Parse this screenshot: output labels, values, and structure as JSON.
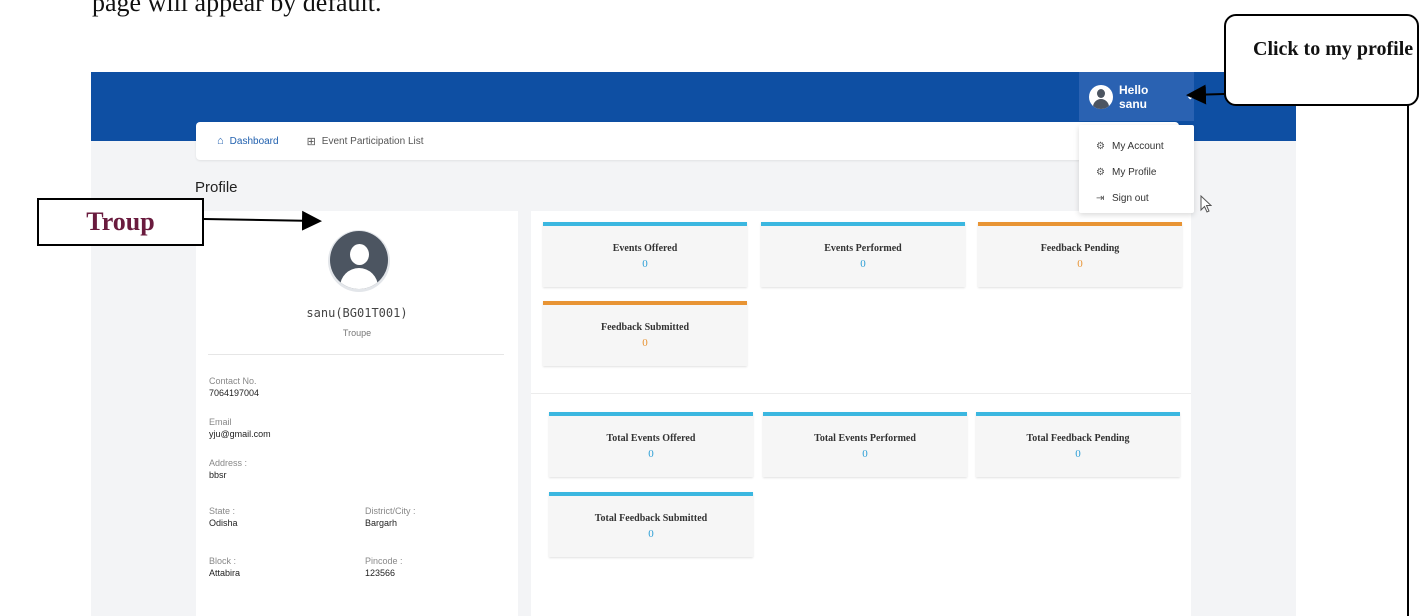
{
  "doc_text": "page will appear by default.",
  "header": {
    "user_greeting": "Hello sanu",
    "caret": "⌄"
  },
  "nav": {
    "items": [
      {
        "label": "Dashboard",
        "icon": "home-icon",
        "glyph": "⌂"
      },
      {
        "label": "Event Participation List",
        "icon": "grid-icon",
        "glyph": "⊞"
      }
    ]
  },
  "page_title": "Profile",
  "dropdown": {
    "items": [
      {
        "label": "My Account",
        "icon": "gear-icon",
        "glyph": "⚙"
      },
      {
        "label": "My Profile",
        "icon": "gear-icon",
        "glyph": "⚙"
      },
      {
        "label": "Sign out",
        "icon": "sign-out-icon",
        "glyph": "⇥"
      }
    ]
  },
  "profile": {
    "name": "sanu(BG01T001)",
    "role": "Troupe",
    "contact_label": "Contact No.",
    "contact_value": "7064197004",
    "email_label": "Email",
    "email_value": "yju@gmail.com",
    "address_label": "Address :",
    "address_value": "bbsr",
    "state_label": "State :",
    "state_value": "Odisha",
    "district_label": "District/City :",
    "district_value": "Bargarh",
    "block_label": "Block :",
    "block_value": "Attabira",
    "pincode_label": "Pincode :",
    "pincode_value": "123566"
  },
  "stats": {
    "current": [
      {
        "title": "Events Offered",
        "value": "0",
        "accent": "#3bb7e0"
      },
      {
        "title": "Events Performed",
        "value": "0",
        "accent": "#3bb7e0"
      },
      {
        "title": "Feedback Pending",
        "value": "0",
        "accent": "#e89434"
      },
      {
        "title": "Feedback Submitted",
        "value": "0",
        "accent": "#e89434"
      }
    ],
    "total": [
      {
        "title": "Total Events Offered",
        "value": "0",
        "accent": "#3bb7e0"
      },
      {
        "title": "Total Events Performed",
        "value": "0",
        "accent": "#3bb7e0"
      },
      {
        "title": "Total Feedback Pending",
        "value": "0",
        "accent": "#3bb7e0"
      },
      {
        "title": "Total Feedback Submitted",
        "value": "0",
        "accent": "#3bb7e0"
      }
    ]
  },
  "annotations": {
    "troup_label": "Troup",
    "callout": "Click to my profile"
  },
  "colors": {
    "header_blue": "#0e4fa3",
    "accent_blue": "#3bb7e0",
    "accent_orange": "#e89434"
  }
}
